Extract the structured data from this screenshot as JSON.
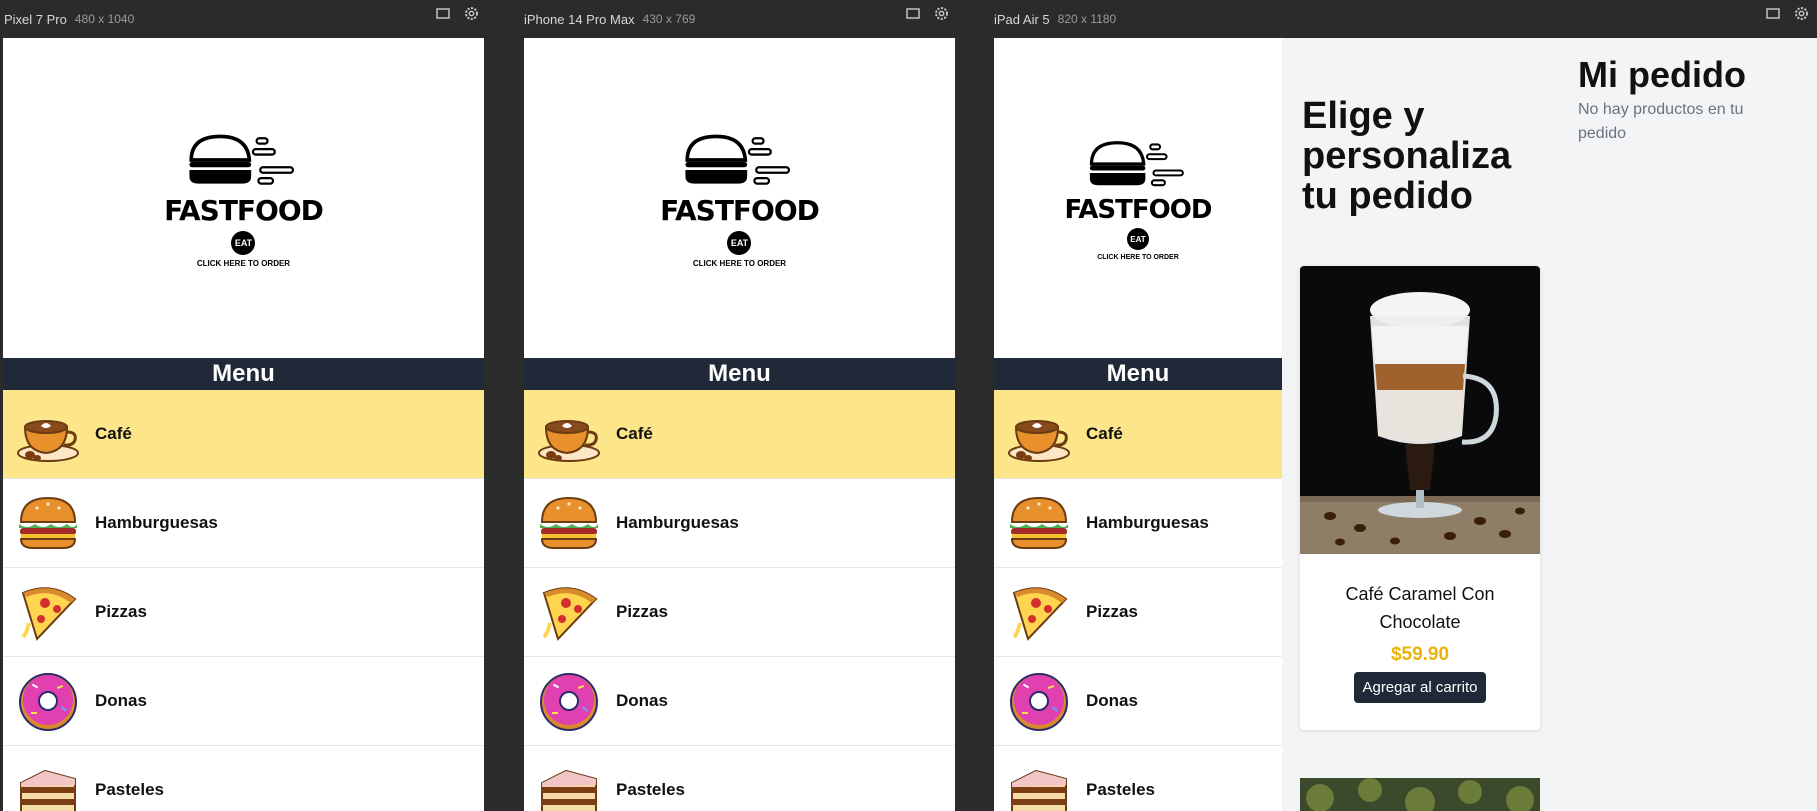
{
  "devices": [
    {
      "name": "Pixel 7 Pro",
      "size": "480 x 1040"
    },
    {
      "name": "iPhone 14 Pro Max",
      "size": "430 x 769"
    },
    {
      "name": "iPad Air 5",
      "size": "820 x 1180"
    }
  ],
  "brand": {
    "title": "FASTFOOD",
    "badge": "EAT",
    "cta": "CLICK HERE TO ORDER"
  },
  "menu": {
    "title": "Menu",
    "categories": [
      {
        "label": "Café",
        "icon": "coffee-icon"
      },
      {
        "label": "Hamburguesas",
        "icon": "burger-icon"
      },
      {
        "label": "Pizzas",
        "icon": "pizza-icon"
      },
      {
        "label": "Donas",
        "icon": "donut-icon"
      },
      {
        "label": "Pasteles",
        "icon": "cake-icon"
      }
    ]
  },
  "main": {
    "heading": "Elige y personaliza tu pedido",
    "product": {
      "name": "Café Caramel Con Chocolate",
      "price": "$59.90",
      "button": "Agregar al carrito"
    }
  },
  "order": {
    "title": "Mi pedido",
    "empty": "No hay productos en tu pedido"
  },
  "colors": {
    "accent": "#eab308",
    "menu_bar": "#1f2937",
    "active_category": "#fde68a"
  }
}
